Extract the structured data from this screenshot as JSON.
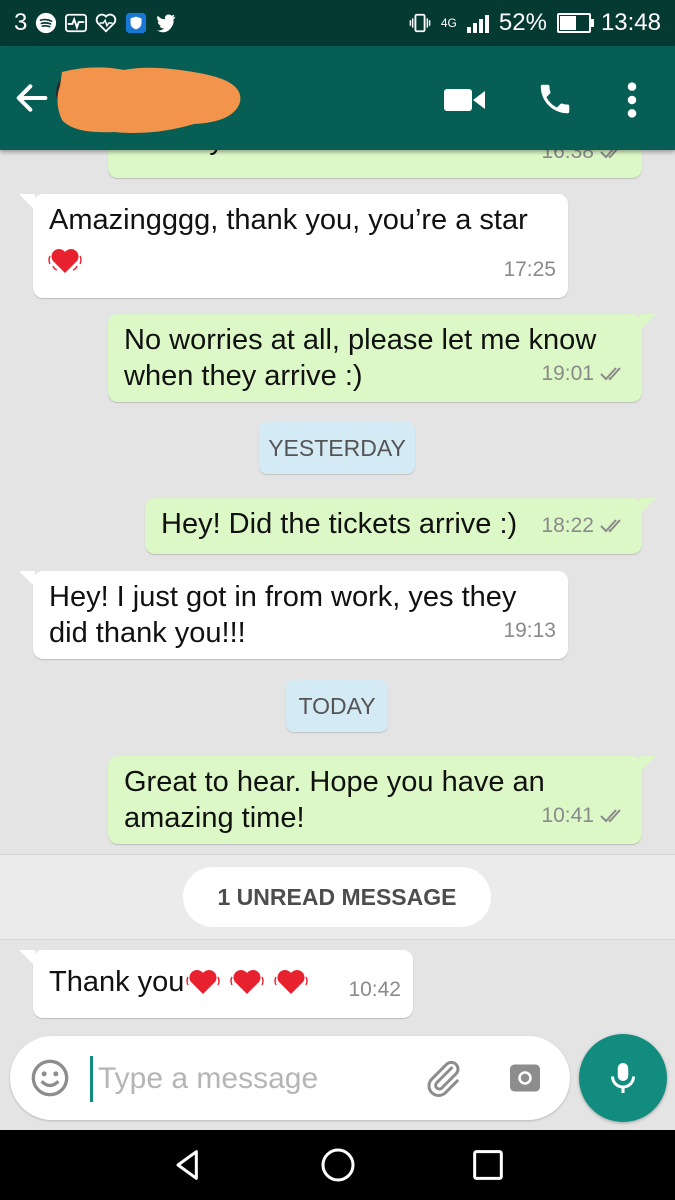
{
  "status_bar": {
    "notification_count": "3",
    "network": "4G",
    "battery": "52%",
    "battery_level": 0.52,
    "time": "13:48"
  },
  "header": {
    "contact_name_redacted": true,
    "icons": [
      "back-arrow-icon",
      "video-call-icon",
      "voice-call-icon",
      "more-vert-icon"
    ]
  },
  "messages": [
    {
      "direction": "out",
      "text": "delivery tomorrow",
      "time": "16:38",
      "status": "read"
    },
    {
      "direction": "in",
      "text": "Amazingggg, thank you, you’re a star",
      "time": "17:25"
    },
    {
      "direction": "out",
      "text": "No worries at all, please let me know\nwhen they arrive :)",
      "time": "19:01",
      "status": "read"
    },
    {
      "type": "date",
      "text": "YESTERDAY"
    },
    {
      "direction": "out",
      "text": "Hey! Did the tickets arrive :)",
      "time": "18:22",
      "status": "read"
    },
    {
      "direction": "in",
      "text": "Hey! I just got in from work, yes they\ndid thank you!!!",
      "time": "19:13"
    },
    {
      "type": "date",
      "text": "TODAY"
    },
    {
      "direction": "out",
      "text": "Great to hear. Hope you have an\namazing time!",
      "time": "10:41",
      "status": "read"
    },
    {
      "type": "unread",
      "text": "1 UNREAD MESSAGE"
    },
    {
      "direction": "in",
      "text": "Thank you",
      "time": "10:42"
    }
  ],
  "input": {
    "placeholder": "Type a message",
    "value": ""
  },
  "colors": {
    "status_bar": "#053a33",
    "header": "#075e54",
    "accent": "#128c7e",
    "outgoing_bubble": "#dcf8c6",
    "incoming_bubble": "#ffffff",
    "date_chip": "#d4eaf4",
    "read_ticks": "#8a8a8a"
  }
}
